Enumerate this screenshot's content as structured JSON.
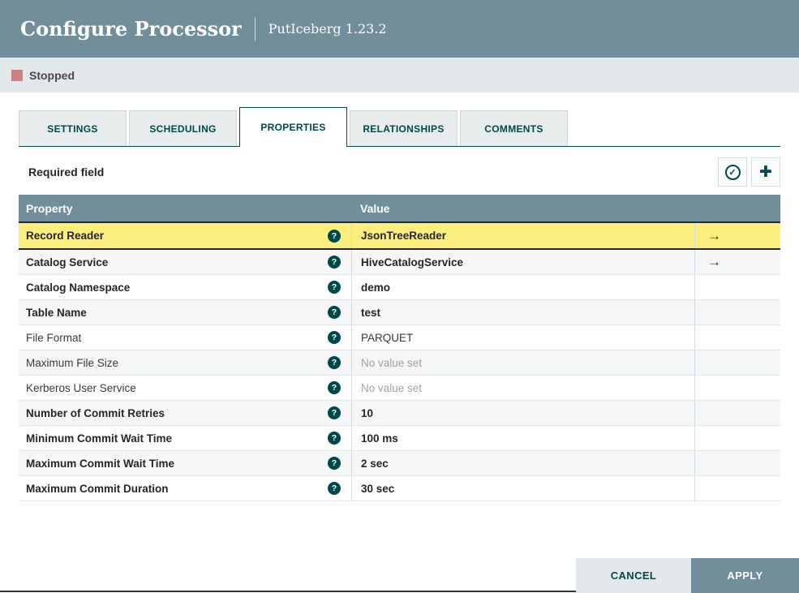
{
  "header": {
    "title": "Configure Processor",
    "subtitle": "PutIceberg 1.23.2"
  },
  "status": {
    "label": "Stopped",
    "icon": "stopped-square-icon",
    "color": "#CA8181"
  },
  "tabs": [
    {
      "label": "SETTINGS",
      "active": false
    },
    {
      "label": "SCHEDULING",
      "active": false
    },
    {
      "label": "PROPERTIES",
      "active": true
    },
    {
      "label": "RELATIONSHIPS",
      "active": false
    },
    {
      "label": "COMMENTS",
      "active": false
    }
  ],
  "toolbar": {
    "required_field_label": "Required field",
    "verify_icon": "circle-check",
    "add_icon": "plus"
  },
  "table": {
    "columns": [
      "Property",
      "Value"
    ],
    "rows": [
      {
        "property": "Record Reader",
        "value": "JsonTreeReader",
        "bold": true,
        "value_bold": true,
        "no_value": false,
        "has_goto": true,
        "highlighted": true
      },
      {
        "property": "Catalog Service",
        "value": "HiveCatalogService",
        "bold": true,
        "value_bold": true,
        "no_value": false,
        "has_goto": true,
        "highlighted": false
      },
      {
        "property": "Catalog Namespace",
        "value": "demo",
        "bold": true,
        "value_bold": true,
        "no_value": false,
        "has_goto": false,
        "highlighted": false
      },
      {
        "property": "Table Name",
        "value": "test",
        "bold": true,
        "value_bold": true,
        "no_value": false,
        "has_goto": false,
        "highlighted": false
      },
      {
        "property": "File Format",
        "value": "PARQUET",
        "bold": false,
        "value_bold": false,
        "no_value": false,
        "has_goto": false,
        "highlighted": false
      },
      {
        "property": "Maximum File Size",
        "value": "No value set",
        "bold": false,
        "value_bold": false,
        "no_value": true,
        "has_goto": false,
        "highlighted": false
      },
      {
        "property": "Kerberos User Service",
        "value": "No value set",
        "bold": false,
        "value_bold": false,
        "no_value": true,
        "has_goto": false,
        "highlighted": false
      },
      {
        "property": "Number of Commit Retries",
        "value": "10",
        "bold": true,
        "value_bold": true,
        "no_value": false,
        "has_goto": false,
        "highlighted": false
      },
      {
        "property": "Minimum Commit Wait Time",
        "value": "100 ms",
        "bold": true,
        "value_bold": true,
        "no_value": false,
        "has_goto": false,
        "highlighted": false
      },
      {
        "property": "Maximum Commit Wait Time",
        "value": "2 sec",
        "bold": true,
        "value_bold": true,
        "no_value": false,
        "has_goto": false,
        "highlighted": false
      },
      {
        "property": "Maximum Commit Duration",
        "value": "30 sec",
        "bold": true,
        "value_bold": true,
        "no_value": false,
        "has_goto": false,
        "highlighted": false
      }
    ]
  },
  "footer": {
    "cancel_label": "CANCEL",
    "apply_label": "APPLY"
  },
  "colors": {
    "header_bg": "#728E9B",
    "status_bar_bg": "#E3E8EB",
    "accent_teal": "#004849",
    "highlight_yellow": "#FBEE7E",
    "stopped_red": "#CA8181",
    "table_header_bg": "#728E9B",
    "alt_row_bg": "#F4F6F7"
  }
}
